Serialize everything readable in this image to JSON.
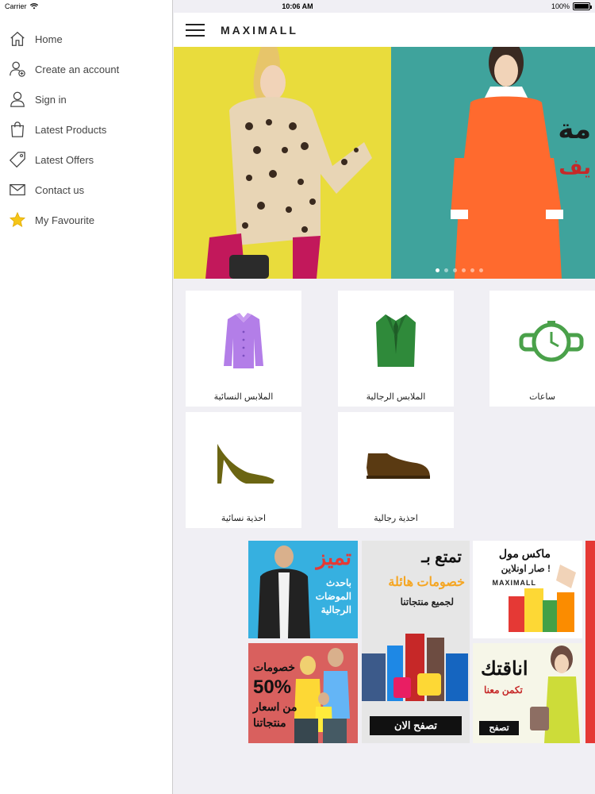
{
  "status": {
    "carrier": "Carrier",
    "time": "10:06 AM",
    "battery": "100%"
  },
  "sidebar": {
    "items": [
      {
        "label": "Home",
        "icon": "home-icon"
      },
      {
        "label": "Create an account",
        "icon": "add-user-icon"
      },
      {
        "label": "Sign in",
        "icon": "user-icon"
      },
      {
        "label": "Latest Products",
        "icon": "shopping-bag-icon"
      },
      {
        "label": "Latest Offers",
        "icon": "tag-icon"
      },
      {
        "label": "Contact us",
        "icon": "mail-icon"
      },
      {
        "label": "My Favourite",
        "icon": "star-icon"
      }
    ]
  },
  "header": {
    "logo": "MAXIMALL"
  },
  "categories": [
    {
      "label": "الملابس النسائية",
      "icon": "women-coat-icon",
      "color": "#b37ee8"
    },
    {
      "label": "الملابس الرجالية",
      "icon": "men-suit-icon",
      "color": "#2f8a3a"
    },
    {
      "label": "ساعات",
      "icon": "watch-icon",
      "color": "#4aa14a"
    },
    {
      "label": "احذية نسائية",
      "icon": "heel-shoe-icon",
      "color": "#6b6512"
    },
    {
      "label": "احذية رجالية",
      "icon": "men-shoe-icon",
      "color": "#5a3a12"
    }
  ],
  "promos": {
    "p1": {
      "l1": "تميز",
      "l2": "باحدث",
      "l3": "الموضات",
      "l4": "الرجالية"
    },
    "p2": {
      "l1": "تمتع بـ",
      "l2": "خصومات هائلة",
      "l3": "لجميع منتجاتنا",
      "cta": "تصفح الان"
    },
    "p3": {
      "l1": "ماكس مول",
      "l2": "صار اونلاين !",
      "l3": "MAXIMALL"
    },
    "p4": {
      "l1": "خصومات",
      "l2": "50%",
      "l3": "من اسعار",
      "l4": "منتجاتنا"
    },
    "p5": {
      "l1": "اناقتك",
      "l2": "تكمن معنا",
      "cta": "تصفح"
    }
  },
  "colors": {
    "accent_yellow": "#e9dc3c",
    "accent_teal": "#3fa39c",
    "promo_blue": "#36b0e0",
    "promo_red": "#d9605e"
  }
}
